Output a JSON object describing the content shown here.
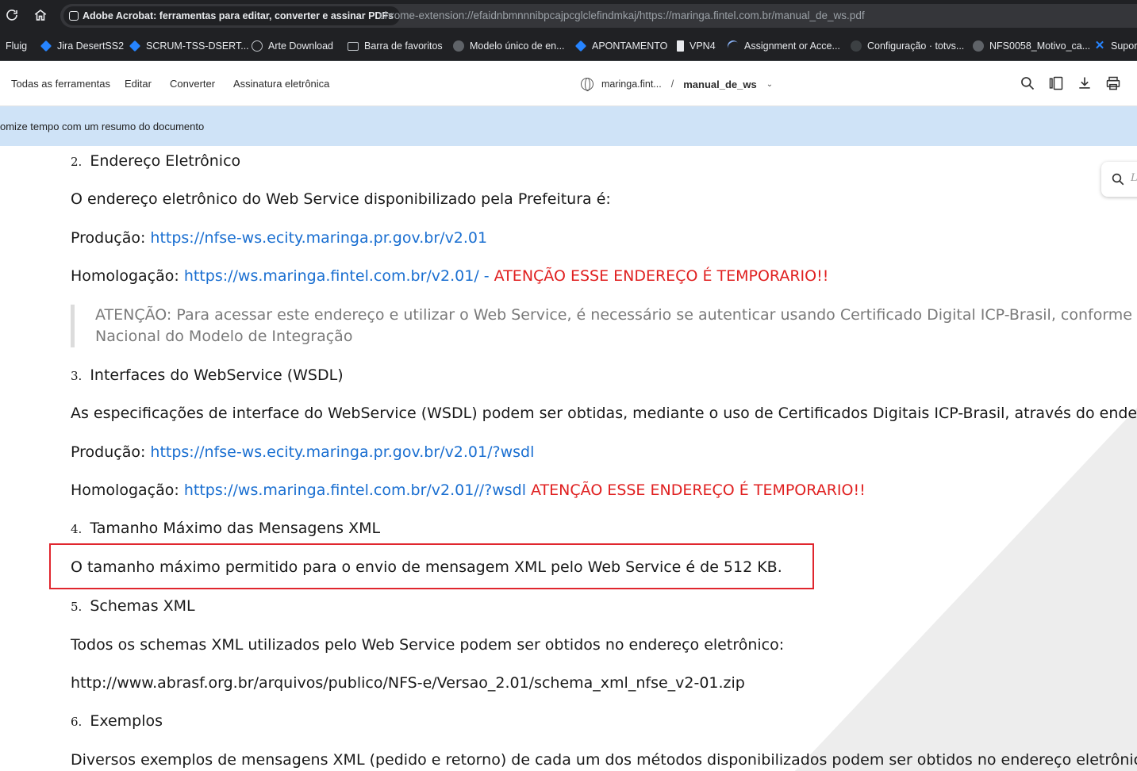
{
  "browser": {
    "extension_label": "Adobe Acrobat: ferramentas para editar, converter e assinar PDFs",
    "url": "chrome-extension://efaidnbmnnnibpcajpcglclefindmkaj/https://maringa.fintel.com.br/manual_de_ws.pdf"
  },
  "bookmarks": [
    {
      "label": "Fluig",
      "icon": "none"
    },
    {
      "label": "Jira DesertSS2",
      "icon": "jira-icon"
    },
    {
      "label": "SCRUM-TSS-DSERT...",
      "icon": "jira-icon"
    },
    {
      "label": "Arte Download",
      "icon": "globe-icon"
    },
    {
      "label": "Barra de favoritos",
      "icon": "folder-icon"
    },
    {
      "label": "Modelo único de en...",
      "icon": "site-icon"
    },
    {
      "label": "APONTAMENTO",
      "icon": "jira-icon"
    },
    {
      "label": "VPN4",
      "icon": "doc-icon"
    },
    {
      "label": "Assignment or Acce...",
      "icon": "site-icon"
    },
    {
      "label": "Configuração · totvs...",
      "icon": "github-icon"
    },
    {
      "label": "NFS0058_Motivo_ca...",
      "icon": "site-icon"
    },
    {
      "label": "Supor",
      "icon": "x-icon"
    }
  ],
  "acrobat": {
    "menu": [
      "Todas as ferramentas",
      "Editar",
      "Converter",
      "Assinatura eletrônica"
    ],
    "breadcrumb_site": "maringa.fint...",
    "breadcrumb_sep": "/",
    "file_name": "manual_de_ws",
    "banner_text": "omize tempo com um resumo do documento",
    "search_hint": "L"
  },
  "document": {
    "s2_num": "2.",
    "s2_title": "Endereço Eletrônico",
    "s2_intro": "O endereço eletrônico do Web Service disponibilizado pela Prefeitura é:",
    "s2_prod_label": "Produção: ",
    "s2_prod_url": "https://nfse-ws.ecity.maringa.pr.gov.br/v2.01",
    "s2_hom_label": "Homologação: ",
    "s2_hom_url": "https://ws.maringa.fintel.com.br/v2.01/ -",
    "s2_hom_warn": " ATENÇÃO ESSE ENDEREÇO É TEMPORARIO!!",
    "quote_line1": "ATENÇÃO: Para acessar este endereço e utilizar o Web Service, é necessário se autenticar usando Certificado Digital ICP-Brasil, conforme e",
    "quote_line2": "Nacional do Modelo de Integração",
    "s3_num": "3.",
    "s3_title": "Interfaces do WebService (WSDL)",
    "s3_intro": "As especificações de interface do WebService (WSDL) podem ser obtidas, mediante o uso de Certificados Digitais ICP-Brasil, através do endere",
    "s3_prod_label": "Produção: ",
    "s3_prod_url": "https://nfse-ws.ecity.maringa.pr.gov.br/v2.01/?wsdl",
    "s3_hom_label": "Homologação: ",
    "s3_hom_url": "https://ws.maringa.fintel.com.br/v2.01//?wsdl",
    "s3_hom_warn": " ATENÇÃO ESSE ENDEREÇO É TEMPORARIO!!",
    "s4_num": "4.",
    "s4_title": "Tamanho Máximo das Mensagens XML",
    "s4_text": "O tamanho máximo permitido para o envio de mensagem XML pelo Web Service é de 512 KB.",
    "s5_num": "5.",
    "s5_title": "Schemas XML",
    "s5_intro": "Todos os schemas XML utilizados pelo Web Service podem ser obtidos no endereço eletrônico:",
    "s5_url": "http://www.abrasf.org.br/arquivos/publico/NFS-e/Versao_2.01/schema_xml_nfse_v2-01.zip",
    "s6_num": "6.",
    "s6_title": "Exemplos",
    "s6_intro": "Diversos exemplos de mensagens XML (pedido e retorno) de cada um dos métodos disponibilizados podem ser obtidos no endereço eletrônico:"
  },
  "colors": {
    "link": "#1a6fd1",
    "warning": "#e02020",
    "highlight_box": "#e0262e",
    "banner": "#cfe3f7"
  }
}
